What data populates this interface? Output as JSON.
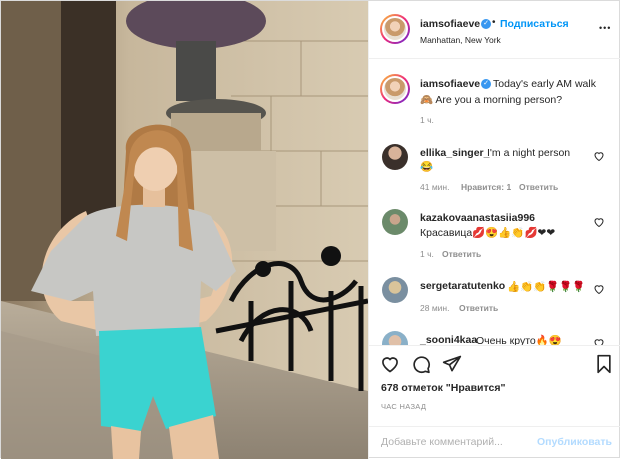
{
  "post": {
    "author": "iamsofiaeve",
    "follow_label": "Подписаться",
    "dot": "•",
    "location": "Manhattan, New York",
    "caption_text": "Today's early AM walk",
    "caption_line2": "🙈 Are you a morning person?",
    "caption_time": "1 ч.",
    "verified_mark": "✓",
    "more_icon": "•••"
  },
  "comments": [
    {
      "user": "ellika_singer_",
      "text": "I'm a night person",
      "line2": "😂",
      "time": "41 мин.",
      "likes": "Нравится: 1",
      "reply": "Ответить"
    },
    {
      "user": "kazakovaanastasiia996",
      "text": "",
      "line2": "Красавица💋😍👍👏💋❤❤",
      "time": "1 ч.",
      "likes": "",
      "reply": "Ответить"
    },
    {
      "user": "sergetaratutenko",
      "text": "👍👏👏🌹🌹🌹",
      "line2": "",
      "time": "28 мин.",
      "likes": "",
      "reply": "Ответить"
    },
    {
      "user": "_sooni4kaa",
      "text": "Очень круто🔥😍",
      "line2": "",
      "time": "",
      "likes": "",
      "reply": ""
    }
  ],
  "stats": {
    "likes": "678 отметок \"Нравится\"",
    "time_ago": "ЧАС НАЗАД"
  },
  "composer": {
    "placeholder": "Добавьте комментарий...",
    "post_label": "Опубликовать"
  },
  "colors": {
    "link_blue": "#0095f6",
    "verified_blue": "#3897f0",
    "skirt": "#3ad3d0"
  }
}
